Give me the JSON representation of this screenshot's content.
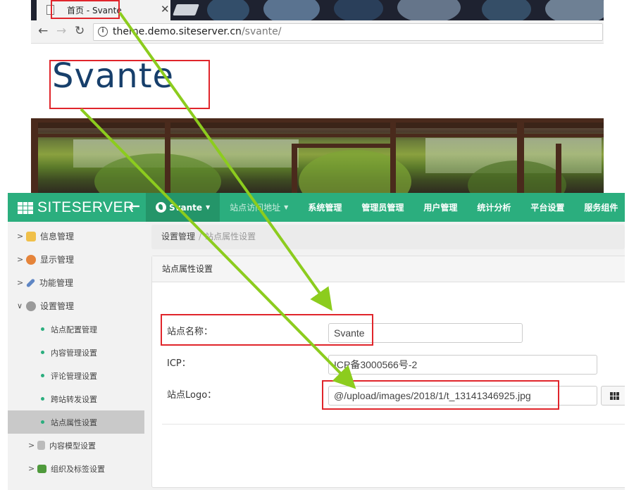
{
  "browser": {
    "tab_title": "首页 - Svante",
    "url_host": "theme.demo.siteserver.cn",
    "url_path": "/svante/",
    "site_logo_text": "Svante"
  },
  "cms": {
    "brand": "SITESERVER",
    "nav": [
      {
        "label": "Svante"
      },
      {
        "label": "站点访问地址"
      },
      {
        "label": "系统管理"
      },
      {
        "label": "管理员管理"
      },
      {
        "label": "用户管理"
      },
      {
        "label": "统计分析"
      },
      {
        "label": "平台设置"
      },
      {
        "label": "服务组件"
      }
    ],
    "sidebar": [
      {
        "label": "信息管理"
      },
      {
        "label": "显示管理"
      },
      {
        "label": "功能管理"
      },
      {
        "label": "设置管理"
      },
      {
        "label": "站点配置管理"
      },
      {
        "label": "内容管理设置"
      },
      {
        "label": "评论管理设置"
      },
      {
        "label": "跨站转发设置"
      },
      {
        "label": "站点属性设置"
      },
      {
        "label": "内容模型设置"
      },
      {
        "label": "组织及标签设置"
      }
    ],
    "breadcrumb": {
      "parent": "设置管理",
      "separator": "/",
      "current": "站点属性设置"
    },
    "panel_title": "站点属性设置",
    "form": {
      "site_name_label": "站点名称：",
      "site_name_value": "Svante",
      "icp_label": "ICP：",
      "icp_value": "ICP备3000566号-2",
      "logo_label": "站点Logo：",
      "logo_value": "@/upload/images/2018/1/t_13141346925.jpg"
    }
  },
  "colors": {
    "topbar": "#2bae7e",
    "highlight_box": "#e0252b",
    "arrow": "#8ccc1e"
  }
}
